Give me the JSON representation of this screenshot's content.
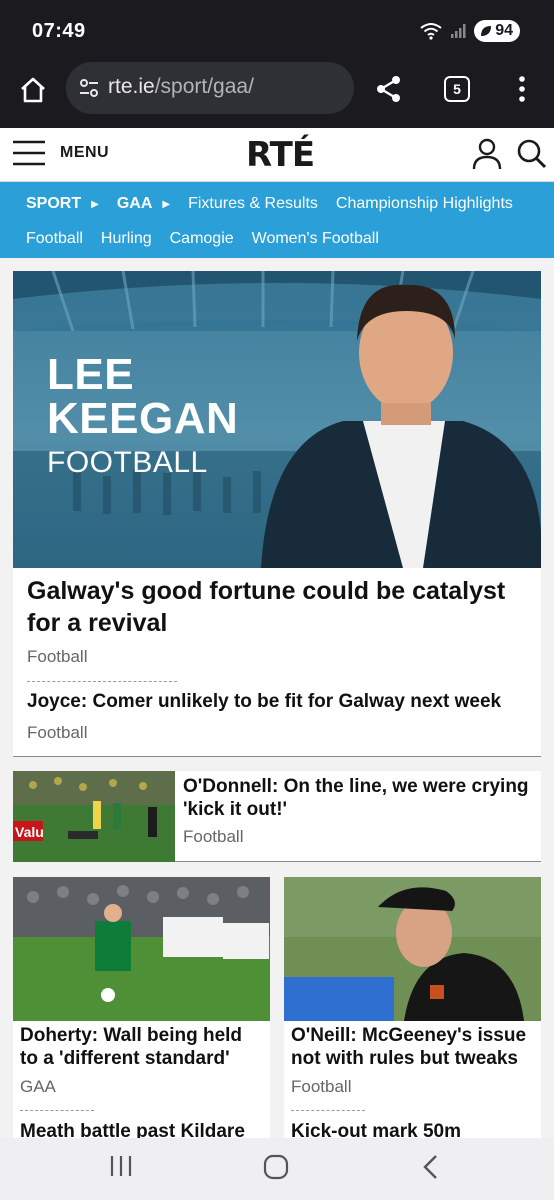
{
  "status": {
    "time": "07:49",
    "battery": "94"
  },
  "browser": {
    "url_domain": "rte.ie",
    "url_path": "/sport/gaa/",
    "tab_count": "5"
  },
  "header": {
    "menu_label": "MENU",
    "logo": "RTÉ"
  },
  "nav": {
    "crumb1": "SPORT",
    "crumb2": "GAA",
    "row1": [
      "Fixtures & Results",
      "Championship Highlights"
    ],
    "row2": [
      "Football",
      "Hurling",
      "Camogie",
      "Women's Football"
    ]
  },
  "lead": {
    "banner_line1": "LEE",
    "banner_line2": "KEEGAN",
    "banner_sub": "FOOTBALL",
    "headline": "Galway's good fortune could be catalyst for a revival",
    "category": "Football",
    "related_title": "Joyce: Comer unlikely to be fit for Galway next week",
    "related_category": "Football"
  },
  "row_story": {
    "title": "O'Donnell: On the line, we were crying 'kick it out!'",
    "category": "Football",
    "sponsor_text": "Valu"
  },
  "grid": [
    {
      "title": "Doherty: Wall being held to a 'different standard'",
      "category": "GAA",
      "next_title": "Meath battle past Kildare"
    },
    {
      "title": "O'Neill: McGeeney's issue not with rules but tweaks",
      "category": "Football",
      "next_title": "Kick-out mark 50m"
    }
  ],
  "colors": {
    "nav_blue": "#2a9fd8",
    "dark_bar": "#1b1b1f"
  }
}
